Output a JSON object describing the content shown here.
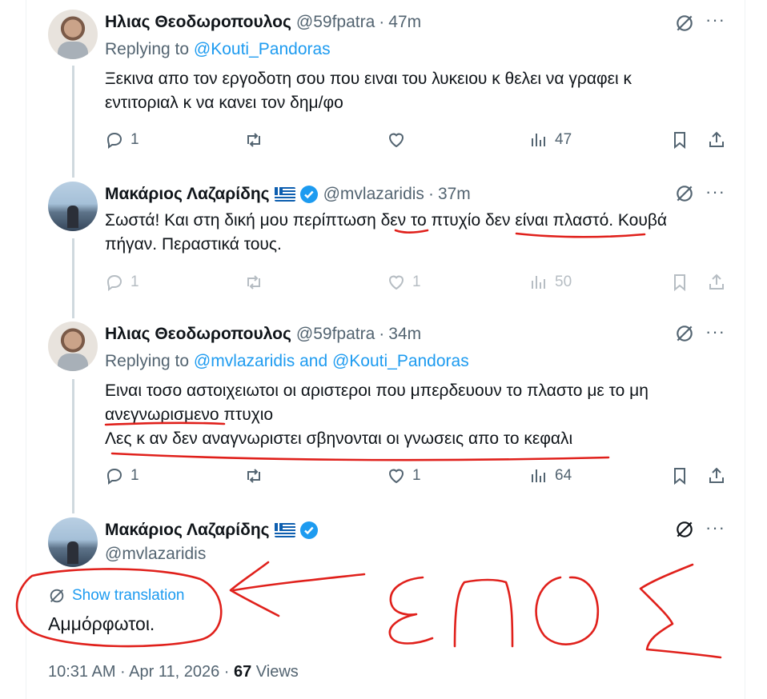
{
  "tweets": [
    {
      "name": "Ηλιας Θεοδωροπουλος",
      "handle": "@59fpatra",
      "time": "47m",
      "replying_prefix": "Replying to",
      "replying_to": "@Kouti_Pandoras",
      "text_lines": [
        "Ξεκινα απο τον εργοδοτη σου που ειναι του λυκειου κ θελει να γραφει κ",
        "εντιτοριαλ κ να κανει τον δημ/φο"
      ],
      "replies": "1",
      "retweets": "",
      "likes": "",
      "views": "47"
    },
    {
      "name": "Μακάριος Λαζαρίδης",
      "handle": "@mvlazaridis",
      "time": "37m",
      "text_lines": [
        "Σωστά! Και στη δική μου περίπτωση δεν το πτυχίο δεν είναι πλαστό. Κουβά",
        "πήγαν. Περαστικά τους."
      ],
      "replies": "1",
      "retweets": "",
      "likes": "1",
      "views": "50"
    },
    {
      "name": "Ηλιας Θεοδωροπουλος",
      "handle": "@59fpatra",
      "time": "34m",
      "replying_prefix": "Replying to",
      "replying_to": "@mvlazaridis and @Kouti_Pandoras",
      "text_lines": [
        "Ειναι τοσο αστοιχειωτοι οι αριστεροι που μπερδευουν το πλαστο με το μη",
        "ανεγνωρισμενο πτυχιο",
        "Λες κ αν δεν αναγνωριστει σβηνονται οι γνωσεις απο το κεφαλι"
      ],
      "replies": "1",
      "retweets": "",
      "likes": "1",
      "views": "64"
    }
  ],
  "main": {
    "name": "Μακάριος Λαζαρίδης",
    "handle": "@mvlazaridis",
    "translation_label": "Show translation",
    "text": "Αμμόρφωτοι.",
    "timestamp": "10:31 AM · Apr 11, 2026 · ",
    "views_count": "67",
    "views_label": " Views"
  },
  "annotation": {
    "handwritten_text": "ΕΠΟΣ",
    "ink_color": "#e0201b"
  },
  "colors": {
    "link": "#1d9bf0",
    "muted": "#536471",
    "text": "#0f1419",
    "verified": "#1d9bf0"
  },
  "icons": [
    "reply-icon",
    "retweet-icon",
    "like-icon",
    "views-icon",
    "bookmark-icon",
    "share-icon",
    "grok-icon",
    "more-icon",
    "verified-badge-icon",
    "greek-flag-icon",
    "translate-icon"
  ]
}
